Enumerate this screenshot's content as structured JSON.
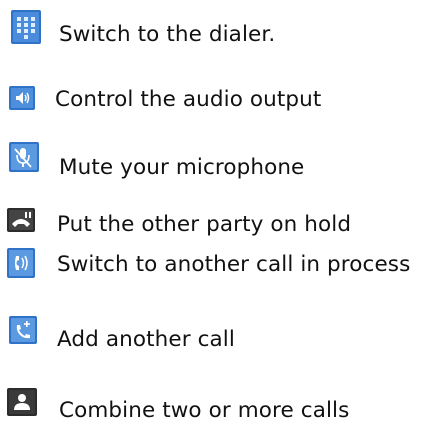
{
  "items": [
    {
      "icon": "dialpad-icon",
      "label": "Switch to the dialer."
    },
    {
      "icon": "speaker-icon",
      "label": "Control the audio output"
    },
    {
      "icon": "microphone-mute-icon",
      "label": "Mute your microphone"
    },
    {
      "icon": "hold-icon",
      "label": "Put the other party on hold"
    },
    {
      "icon": "swap-call-icon",
      "label": "Switch to another call in process"
    },
    {
      "icon": "add-call-icon",
      "label": "Add another call"
    },
    {
      "icon": "merge-calls-icon",
      "label": "Combine two or more calls"
    }
  ],
  "colors": {
    "icon_blue": "#2f72c8",
    "icon_blue_light": "#5b99e0",
    "icon_dark": "#2c2c2c",
    "text": "#111111"
  }
}
